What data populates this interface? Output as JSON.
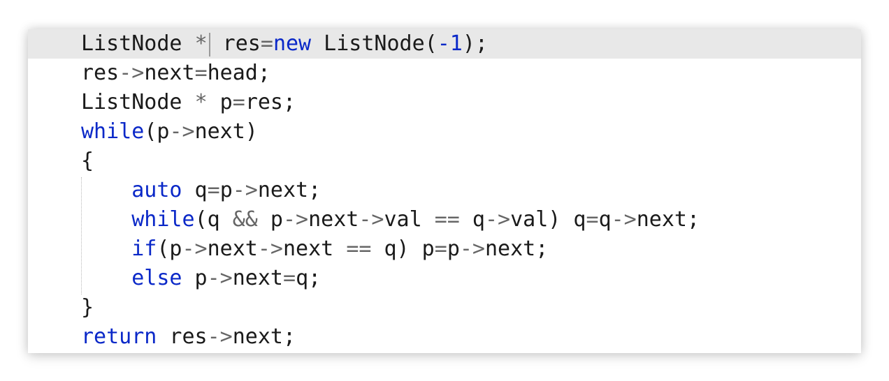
{
  "code_lines": [
    {
      "tokens": [
        {
          "t": "ListNode "
        },
        {
          "t": "*",
          "c": "op"
        },
        {
          "t": "",
          "c": "cursor"
        },
        {
          "t": " res"
        },
        {
          "t": "=",
          "c": "op"
        },
        {
          "t": "new",
          "c": "kw"
        },
        {
          "t": " ListNode("
        },
        {
          "t": "-1",
          "c": "num"
        },
        {
          "t": ");"
        }
      ]
    },
    {
      "tokens": [
        {
          "t": "res"
        },
        {
          "t": "->",
          "c": "op"
        },
        {
          "t": "next"
        },
        {
          "t": "=",
          "c": "op"
        },
        {
          "t": "head;"
        }
      ]
    },
    {
      "tokens": [
        {
          "t": "ListNode "
        },
        {
          "t": "*",
          "c": "op"
        },
        {
          "t": " p"
        },
        {
          "t": "=",
          "c": "op"
        },
        {
          "t": "res;"
        }
      ]
    },
    {
      "tokens": [
        {
          "t": "while",
          "c": "kw"
        },
        {
          "t": "(p"
        },
        {
          "t": "->",
          "c": "op"
        },
        {
          "t": "next)"
        }
      ]
    },
    {
      "tokens": [
        {
          "t": "{"
        }
      ]
    },
    {
      "tokens": [
        {
          "t": "    "
        },
        {
          "t": "auto",
          "c": "kw"
        },
        {
          "t": " q"
        },
        {
          "t": "=",
          "c": "op"
        },
        {
          "t": "p"
        },
        {
          "t": "->",
          "c": "op"
        },
        {
          "t": "next;"
        }
      ]
    },
    {
      "tokens": [
        {
          "t": "    "
        },
        {
          "t": "while",
          "c": "kw"
        },
        {
          "t": "(q "
        },
        {
          "t": "&&",
          "c": "op"
        },
        {
          "t": " p"
        },
        {
          "t": "->",
          "c": "op"
        },
        {
          "t": "next"
        },
        {
          "t": "->",
          "c": "op"
        },
        {
          "t": "val "
        },
        {
          "t": "==",
          "c": "op"
        },
        {
          "t": " q"
        },
        {
          "t": "->",
          "c": "op"
        },
        {
          "t": "val) q"
        },
        {
          "t": "=",
          "c": "op"
        },
        {
          "t": "q"
        },
        {
          "t": "->",
          "c": "op"
        },
        {
          "t": "next;"
        }
      ]
    },
    {
      "tokens": [
        {
          "t": "    "
        },
        {
          "t": "if",
          "c": "kw"
        },
        {
          "t": "(p"
        },
        {
          "t": "->",
          "c": "op"
        },
        {
          "t": "next"
        },
        {
          "t": "->",
          "c": "op"
        },
        {
          "t": "next "
        },
        {
          "t": "==",
          "c": "op"
        },
        {
          "t": " q) p"
        },
        {
          "t": "=",
          "c": "op"
        },
        {
          "t": "p"
        },
        {
          "t": "->",
          "c": "op"
        },
        {
          "t": "next;"
        }
      ]
    },
    {
      "tokens": [
        {
          "t": "    "
        },
        {
          "t": "else",
          "c": "kw"
        },
        {
          "t": " p"
        },
        {
          "t": "->",
          "c": "op"
        },
        {
          "t": "next"
        },
        {
          "t": "=",
          "c": "op"
        },
        {
          "t": "q;"
        }
      ]
    },
    {
      "tokens": [
        {
          "t": "}"
        }
      ]
    },
    {
      "tokens": [
        {
          "t": "return",
          "c": "kw"
        },
        {
          "t": " res"
        },
        {
          "t": "->",
          "c": "op"
        },
        {
          "t": "next;"
        }
      ]
    }
  ],
  "current_line": 0,
  "colors": {
    "keyword": "#0a28c8",
    "operator": "#666666",
    "text": "#1a1a1a",
    "current_line_bg": "#e8e8e8"
  }
}
